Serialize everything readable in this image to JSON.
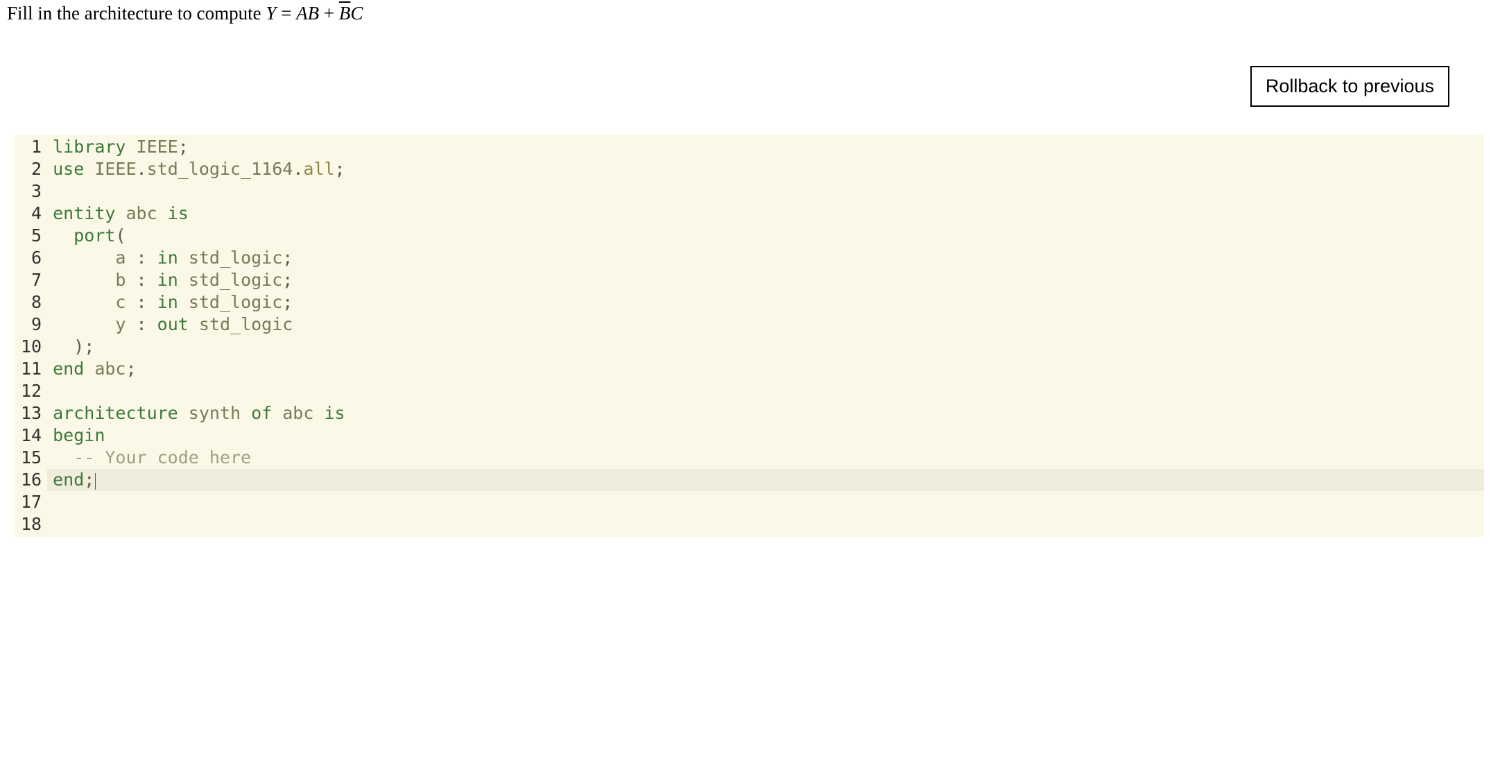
{
  "prompt": {
    "prefix": "Fill in the architecture to compute ",
    "lhs": "Y",
    "eq": " = ",
    "t1a": "A",
    "t1b": "B",
    "plus": " + ",
    "t2a_bar": "B",
    "t2b": "C"
  },
  "button": {
    "rollback_label": "Rollback to previous"
  },
  "code": {
    "lines": [
      {
        "n": 1,
        "tokens": [
          {
            "cls": "tok-kw",
            "t": "library"
          },
          {
            "cls": "tok-plain",
            "t": " IEEE"
          },
          {
            "cls": "tok-punc",
            "t": ";"
          }
        ]
      },
      {
        "n": 2,
        "tokens": [
          {
            "cls": "tok-kw",
            "t": "use"
          },
          {
            "cls": "tok-plain",
            "t": " IEEE"
          },
          {
            "cls": "tok-punc",
            "t": "."
          },
          {
            "cls": "tok-plain",
            "t": "std_logic_1164"
          },
          {
            "cls": "tok-punc",
            "t": "."
          },
          {
            "cls": "tok-attr",
            "t": "all"
          },
          {
            "cls": "tok-punc",
            "t": ";"
          }
        ]
      },
      {
        "n": 3,
        "tokens": [
          {
            "cls": "tok-plain",
            "t": ""
          }
        ]
      },
      {
        "n": 4,
        "tokens": [
          {
            "cls": "tok-kw",
            "t": "entity"
          },
          {
            "cls": "tok-plain",
            "t": " abc "
          },
          {
            "cls": "tok-kw",
            "t": "is"
          }
        ]
      },
      {
        "n": 5,
        "tokens": [
          {
            "cls": "tok-plain",
            "t": "  "
          },
          {
            "cls": "tok-kw",
            "t": "port"
          },
          {
            "cls": "tok-punc",
            "t": "("
          }
        ]
      },
      {
        "n": 6,
        "tokens": [
          {
            "cls": "tok-plain",
            "t": "      a "
          },
          {
            "cls": "tok-punc",
            "t": ":"
          },
          {
            "cls": "tok-plain",
            "t": " "
          },
          {
            "cls": "tok-kw",
            "t": "in"
          },
          {
            "cls": "tok-plain",
            "t": " std_logic"
          },
          {
            "cls": "tok-punc",
            "t": ";"
          }
        ]
      },
      {
        "n": 7,
        "tokens": [
          {
            "cls": "tok-plain",
            "t": "      b "
          },
          {
            "cls": "tok-punc",
            "t": ":"
          },
          {
            "cls": "tok-plain",
            "t": " "
          },
          {
            "cls": "tok-kw",
            "t": "in"
          },
          {
            "cls": "tok-plain",
            "t": " std_logic"
          },
          {
            "cls": "tok-punc",
            "t": ";"
          }
        ]
      },
      {
        "n": 8,
        "tokens": [
          {
            "cls": "tok-plain",
            "t": "      c "
          },
          {
            "cls": "tok-punc",
            "t": ":"
          },
          {
            "cls": "tok-plain",
            "t": " "
          },
          {
            "cls": "tok-kw",
            "t": "in"
          },
          {
            "cls": "tok-plain",
            "t": " std_logic"
          },
          {
            "cls": "tok-punc",
            "t": ";"
          }
        ]
      },
      {
        "n": 9,
        "tokens": [
          {
            "cls": "tok-plain",
            "t": "      y "
          },
          {
            "cls": "tok-punc",
            "t": ":"
          },
          {
            "cls": "tok-plain",
            "t": " "
          },
          {
            "cls": "tok-kw",
            "t": "out"
          },
          {
            "cls": "tok-plain",
            "t": " std_logic"
          }
        ]
      },
      {
        "n": 10,
        "tokens": [
          {
            "cls": "tok-plain",
            "t": "  "
          },
          {
            "cls": "tok-punc",
            "t": ")"
          },
          {
            "cls": "tok-punc",
            "t": ";"
          }
        ]
      },
      {
        "n": 11,
        "tokens": [
          {
            "cls": "tok-kw",
            "t": "end"
          },
          {
            "cls": "tok-plain",
            "t": " abc"
          },
          {
            "cls": "tok-punc",
            "t": ";"
          }
        ]
      },
      {
        "n": 12,
        "tokens": [
          {
            "cls": "tok-plain",
            "t": ""
          }
        ]
      },
      {
        "n": 13,
        "tokens": [
          {
            "cls": "tok-kw",
            "t": "architecture"
          },
          {
            "cls": "tok-plain",
            "t": " synth "
          },
          {
            "cls": "tok-kw",
            "t": "of"
          },
          {
            "cls": "tok-plain",
            "t": " abc "
          },
          {
            "cls": "tok-kw",
            "t": "is"
          }
        ]
      },
      {
        "n": 14,
        "tokens": [
          {
            "cls": "tok-kw",
            "t": "begin"
          }
        ]
      },
      {
        "n": 15,
        "tokens": [
          {
            "cls": "tok-plain",
            "t": "  "
          },
          {
            "cls": "tok-comment",
            "t": "-- Your code here"
          }
        ]
      },
      {
        "n": 16,
        "tokens": [
          {
            "cls": "tok-kw",
            "t": "end"
          },
          {
            "cls": "tok-punc",
            "t": ";"
          }
        ],
        "active": true,
        "cursor_after": true
      },
      {
        "n": 17,
        "tokens": [
          {
            "cls": "tok-plain",
            "t": ""
          }
        ]
      },
      {
        "n": 18,
        "tokens": [
          {
            "cls": "tok-plain",
            "t": ""
          }
        ]
      }
    ]
  }
}
